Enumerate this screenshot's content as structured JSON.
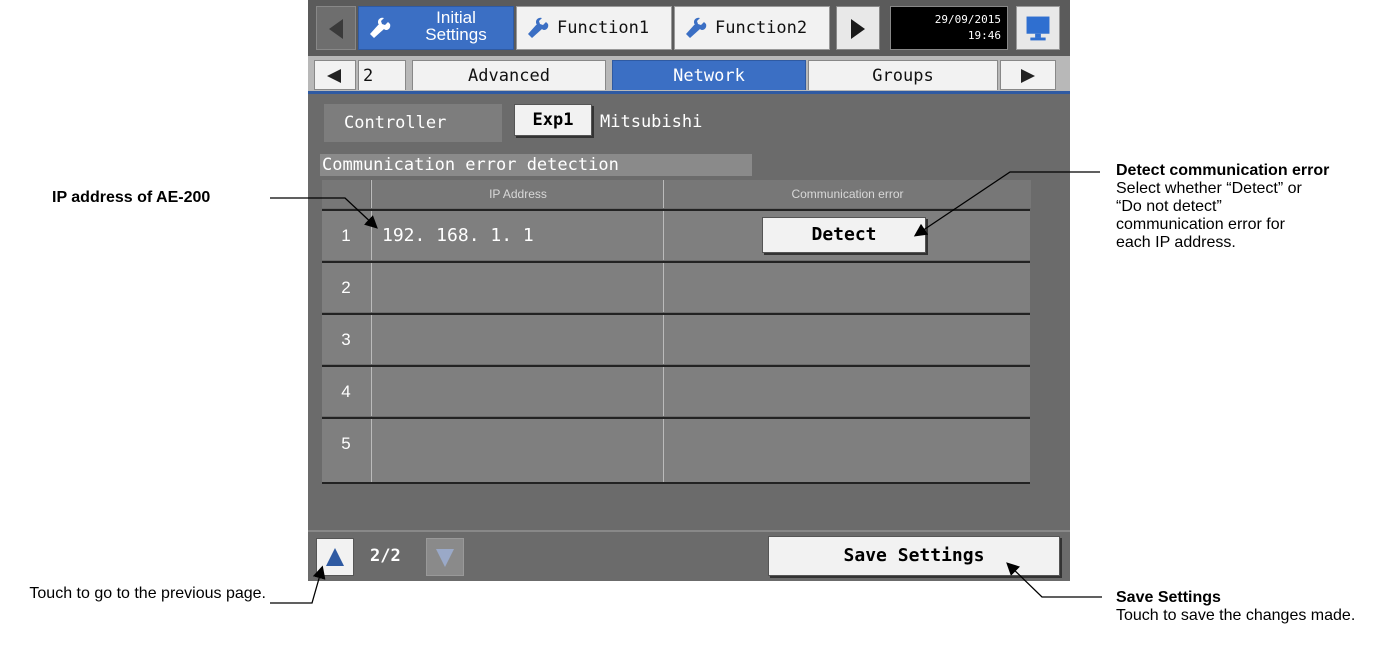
{
  "topbar": {
    "tabs": [
      {
        "label": "Initial\nSettings",
        "icon": "wrench-icon",
        "active": true
      },
      {
        "label": "Function1",
        "icon": "wrench-icon",
        "active": false
      },
      {
        "label": "Function2",
        "icon": "wrench-icon",
        "active": false
      }
    ],
    "date": "29/09/2015",
    "time": "19:46",
    "monitor_icon": "monitor-icon"
  },
  "subtabs": {
    "items": [
      {
        "label": "2",
        "active": false
      },
      {
        "label": "Advanced",
        "active": false
      },
      {
        "label": "Network",
        "active": true
      },
      {
        "label": "Groups",
        "active": false
      }
    ]
  },
  "controller": {
    "label": "Controller",
    "button": "Exp1",
    "name": "Mitsubishi"
  },
  "section": {
    "title": "Communication error detection"
  },
  "table": {
    "columns": [
      "IP Address",
      "Communication error"
    ],
    "rows": [
      {
        "num": "1",
        "ip": "192. 168. 1. 1",
        "error": "Detect"
      },
      {
        "num": "2",
        "ip": "",
        "error": ""
      },
      {
        "num": "3",
        "ip": "",
        "error": ""
      },
      {
        "num": "4",
        "ip": "",
        "error": ""
      },
      {
        "num": "5",
        "ip": "",
        "error": ""
      }
    ]
  },
  "footer": {
    "page": "2/2",
    "save_label": "Save Settings"
  },
  "annotations": {
    "ip_address": "IP address of AE-200",
    "detect_title": "Detect communication error",
    "detect_desc": "Select whether “Detect” or “Do not detect” communication error for each IP address.",
    "prev_page": "Touch to go to the previous page.",
    "save_title": "Save Settings",
    "save_desc": "Touch to save the changes made."
  },
  "colors": {
    "accent": "#3b6fc4",
    "screen_bg": "#6b6b6b"
  }
}
